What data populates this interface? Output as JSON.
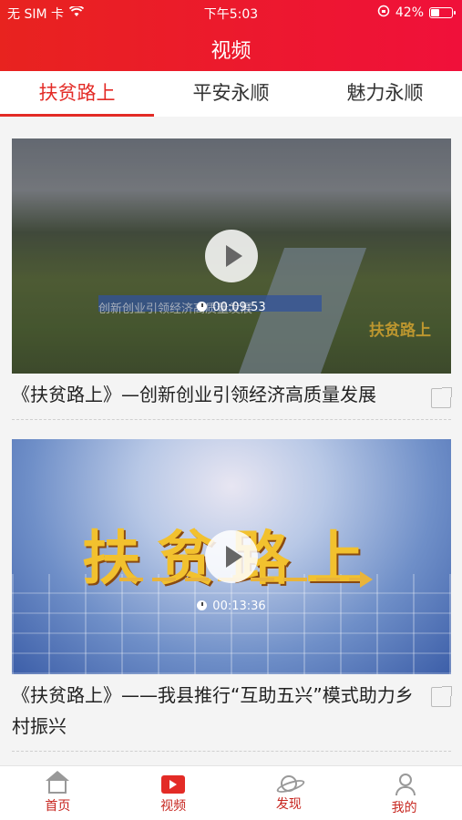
{
  "status": {
    "carrier": "无 SIM 卡",
    "time": "下午5:03",
    "battery": "42%",
    "battery_level": 0.42
  },
  "header": {
    "title": "视频"
  },
  "tabs": [
    {
      "label": "扶贫路上",
      "active": true
    },
    {
      "label": "平安永顺",
      "active": false
    },
    {
      "label": "魅力永顺",
      "active": false
    }
  ],
  "videos": [
    {
      "duration": "00:09:53",
      "title": "《扶贫路上》—创新创业引领经济高质量发展",
      "overlay_text": "扶贫路上",
      "caption": "创新创业引领经济高质量发展"
    },
    {
      "duration": "00:13:36",
      "title": "《扶贫路上》——我县推行“互助五兴”模式助力乡村振兴",
      "overlay_text": "扶贫路上"
    }
  ],
  "nav": [
    {
      "label": "首页",
      "icon": "home-icon"
    },
    {
      "label": "视频",
      "icon": "video-icon",
      "active": true
    },
    {
      "label": "发现",
      "icon": "planet-icon"
    },
    {
      "label": "我的",
      "icon": "user-icon"
    }
  ],
  "colors": {
    "accent": "#e32b26",
    "header_start": "#e8231f",
    "header_end": "#f0103a"
  }
}
